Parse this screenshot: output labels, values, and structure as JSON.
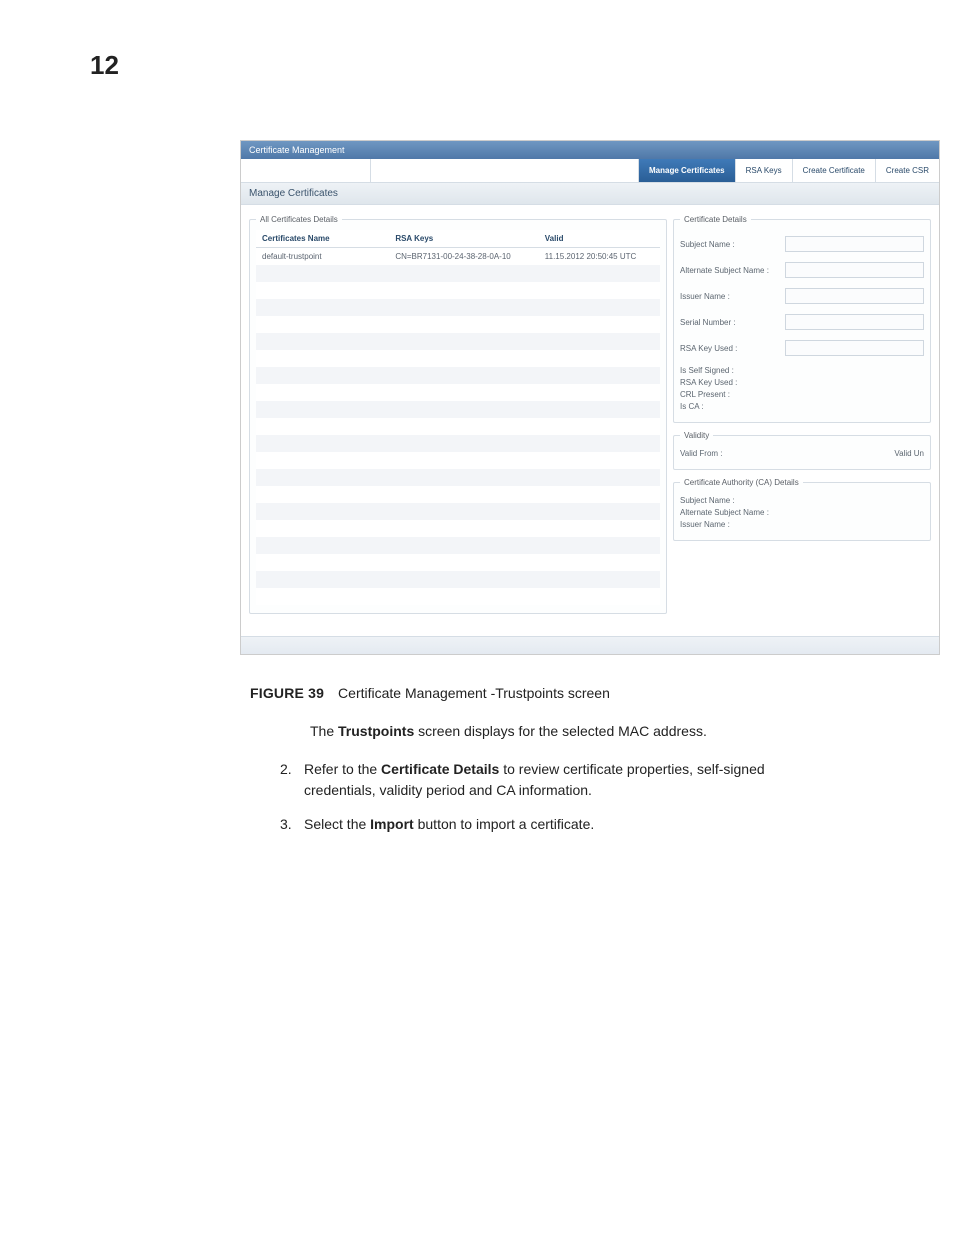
{
  "page_number": "12",
  "figure": {
    "label": "FIGURE 39",
    "title": "Certificate Management -Trustpoints screen"
  },
  "paragraph_intro_pre": "The ",
  "paragraph_intro_bold": "Trustpoints",
  "paragraph_intro_post": " screen displays for the selected MAC address.",
  "step2": {
    "num": "2.",
    "pre": "Refer to the ",
    "bold": "Certificate Details",
    "post": " to review certificate properties, self-signed credentials, validity period and CA information."
  },
  "step3": {
    "num": "3.",
    "pre": "Select the ",
    "bold": "Import",
    "post": " button to import a certificate."
  },
  "ui": {
    "title": "Certificate Management",
    "tabs": {
      "manage": "Manage Certificates",
      "rsa": "RSA Keys",
      "create_cert": "Create Certificate",
      "create_csr": "Create CSR"
    },
    "subheader": "Manage Certificates",
    "left_legend": "All Certificates Details",
    "table": {
      "cols": {
        "name": "Certificates Name",
        "rsa": "RSA Keys",
        "valid": "Valid"
      },
      "row": {
        "name": "default-trustpoint",
        "rsa": "CN=BR7131-00-24-38-28-0A-10",
        "valid": "11.15.2012 20:50:45 UTC"
      }
    },
    "details": {
      "legend": "Certificate Details",
      "subject_name": "Subject Name :",
      "alt_subject_name": "Alternate Subject Name :",
      "issuer_name": "Issuer Name :",
      "serial_number": "Serial Number :",
      "rsa_key_used": "RSA Key Used :",
      "is_self_signed": "Is Self Signed :",
      "rsa_key_used2": "RSA Key Used :",
      "crl_present": "CRL Present :",
      "is_ca": "Is CA :"
    },
    "validity": {
      "legend": "Validity",
      "from": "Valid From :",
      "until": "Valid Un"
    },
    "ca": {
      "legend": "Certificate Authority (CA) Details",
      "subject_name": "Subject Name :",
      "alt_subject_name": "Alternate Subject Name :",
      "issuer_name": "Issuer Name :"
    }
  }
}
